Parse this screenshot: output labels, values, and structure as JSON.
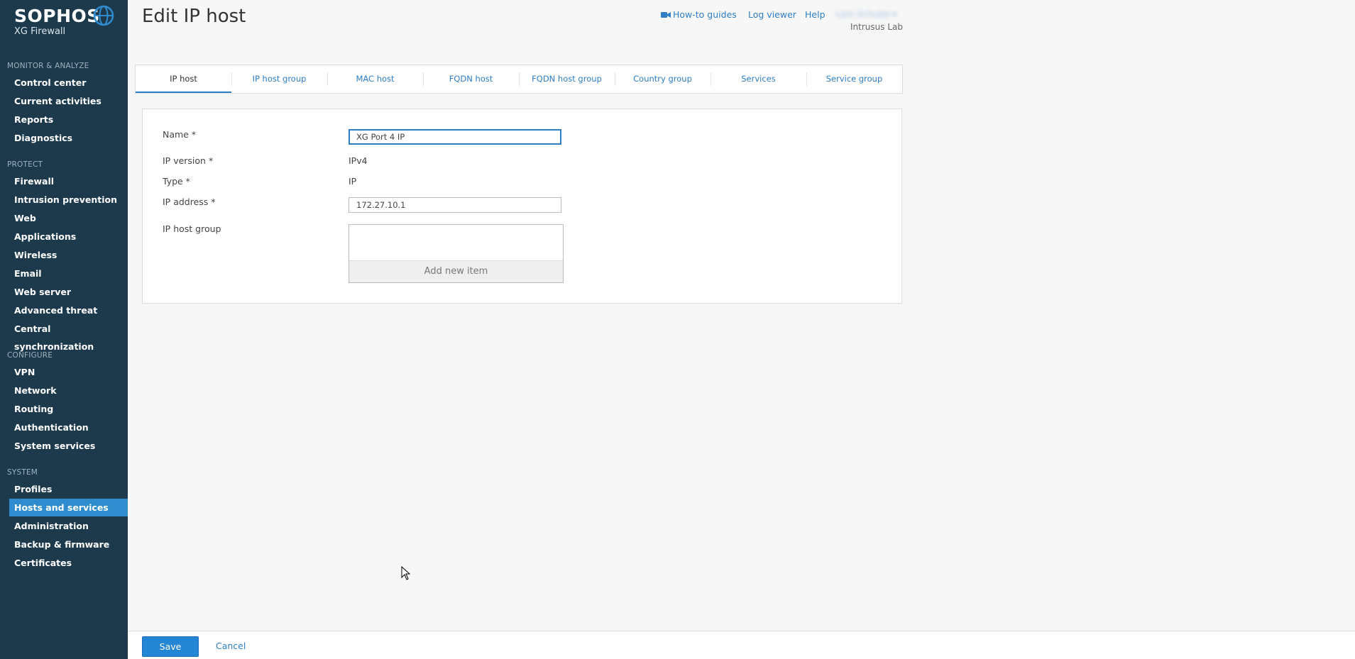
{
  "brand": {
    "name": "SOPHOS",
    "product": "XG Firewall"
  },
  "header": {
    "title": "Edit IP host",
    "links": {
      "guides": "How-to guides",
      "log_viewer": "Log viewer",
      "help": "Help"
    },
    "user": "Lars Schulze ▾",
    "org": "Intrusus Lab"
  },
  "sidebar": {
    "sections": [
      {
        "title": "MONITOR & ANALYZE",
        "items": [
          "Control center",
          "Current activities",
          "Reports",
          "Diagnostics"
        ]
      },
      {
        "title": "PROTECT",
        "items": [
          "Firewall",
          "Intrusion prevention",
          "Web",
          "Applications",
          "Wireless",
          "Email",
          "Web server",
          "Advanced threat",
          "Central synchronization"
        ]
      },
      {
        "title": "CONFIGURE",
        "items": [
          "VPN",
          "Network",
          "Routing",
          "Authentication",
          "System services"
        ]
      },
      {
        "title": "SYSTEM",
        "items": [
          "Profiles",
          "Hosts and services",
          "Administration",
          "Backup & firmware",
          "Certificates"
        ]
      }
    ],
    "active": "Hosts and services"
  },
  "tabs": [
    "IP host",
    "IP host group",
    "MAC host",
    "FQDN host",
    "FQDN host group",
    "Country group",
    "Services",
    "Service group"
  ],
  "active_tab": "IP host",
  "form": {
    "name_label": "Name *",
    "name_value": "XG Port 4 IP",
    "ip_version_label": "IP version *",
    "ip_version_value": "IPv4",
    "type_label": "Type *",
    "type_value": "IP",
    "ip_address_label": "IP address *",
    "ip_address_value": "172.27.10.1",
    "host_group_label": "IP host group",
    "add_new_item": "Add new item"
  },
  "footer": {
    "save": "Save",
    "cancel": "Cancel"
  },
  "colors": {
    "sidebar_bg": "#1d3a4d",
    "accent": "#2e8ccf",
    "link": "#2d7ec4"
  }
}
